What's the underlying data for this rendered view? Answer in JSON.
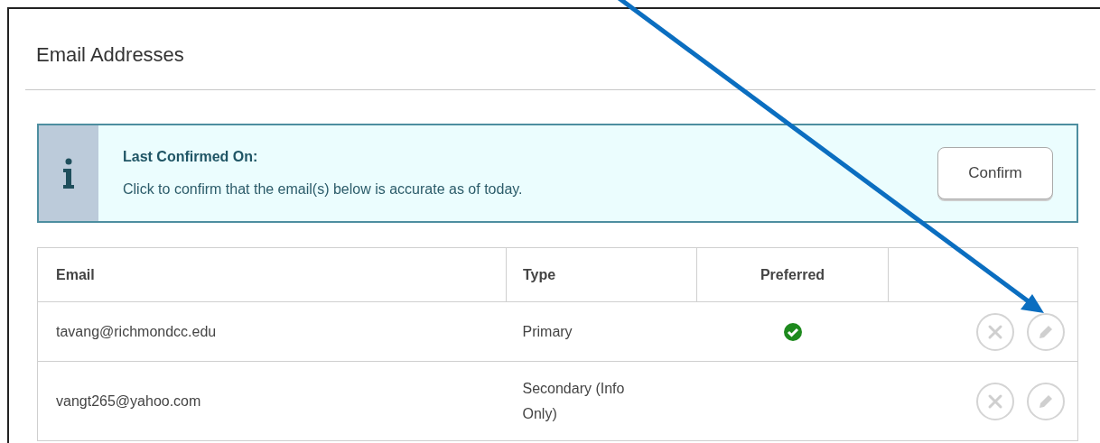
{
  "heading": "Email Addresses",
  "notice": {
    "title": "Last Confirmed On:",
    "message": "Click to confirm that the email(s) below is accurate as of today.",
    "button": "Confirm"
  },
  "table": {
    "columns": [
      "Email",
      "Type",
      "Preferred"
    ],
    "rows": [
      {
        "email": "tavang@richmondcc.edu",
        "type": "Primary",
        "preferred": true
      },
      {
        "email": "vangt265@yahoo.com",
        "type": "Secondary (Info Only)",
        "preferred": false
      }
    ]
  }
}
